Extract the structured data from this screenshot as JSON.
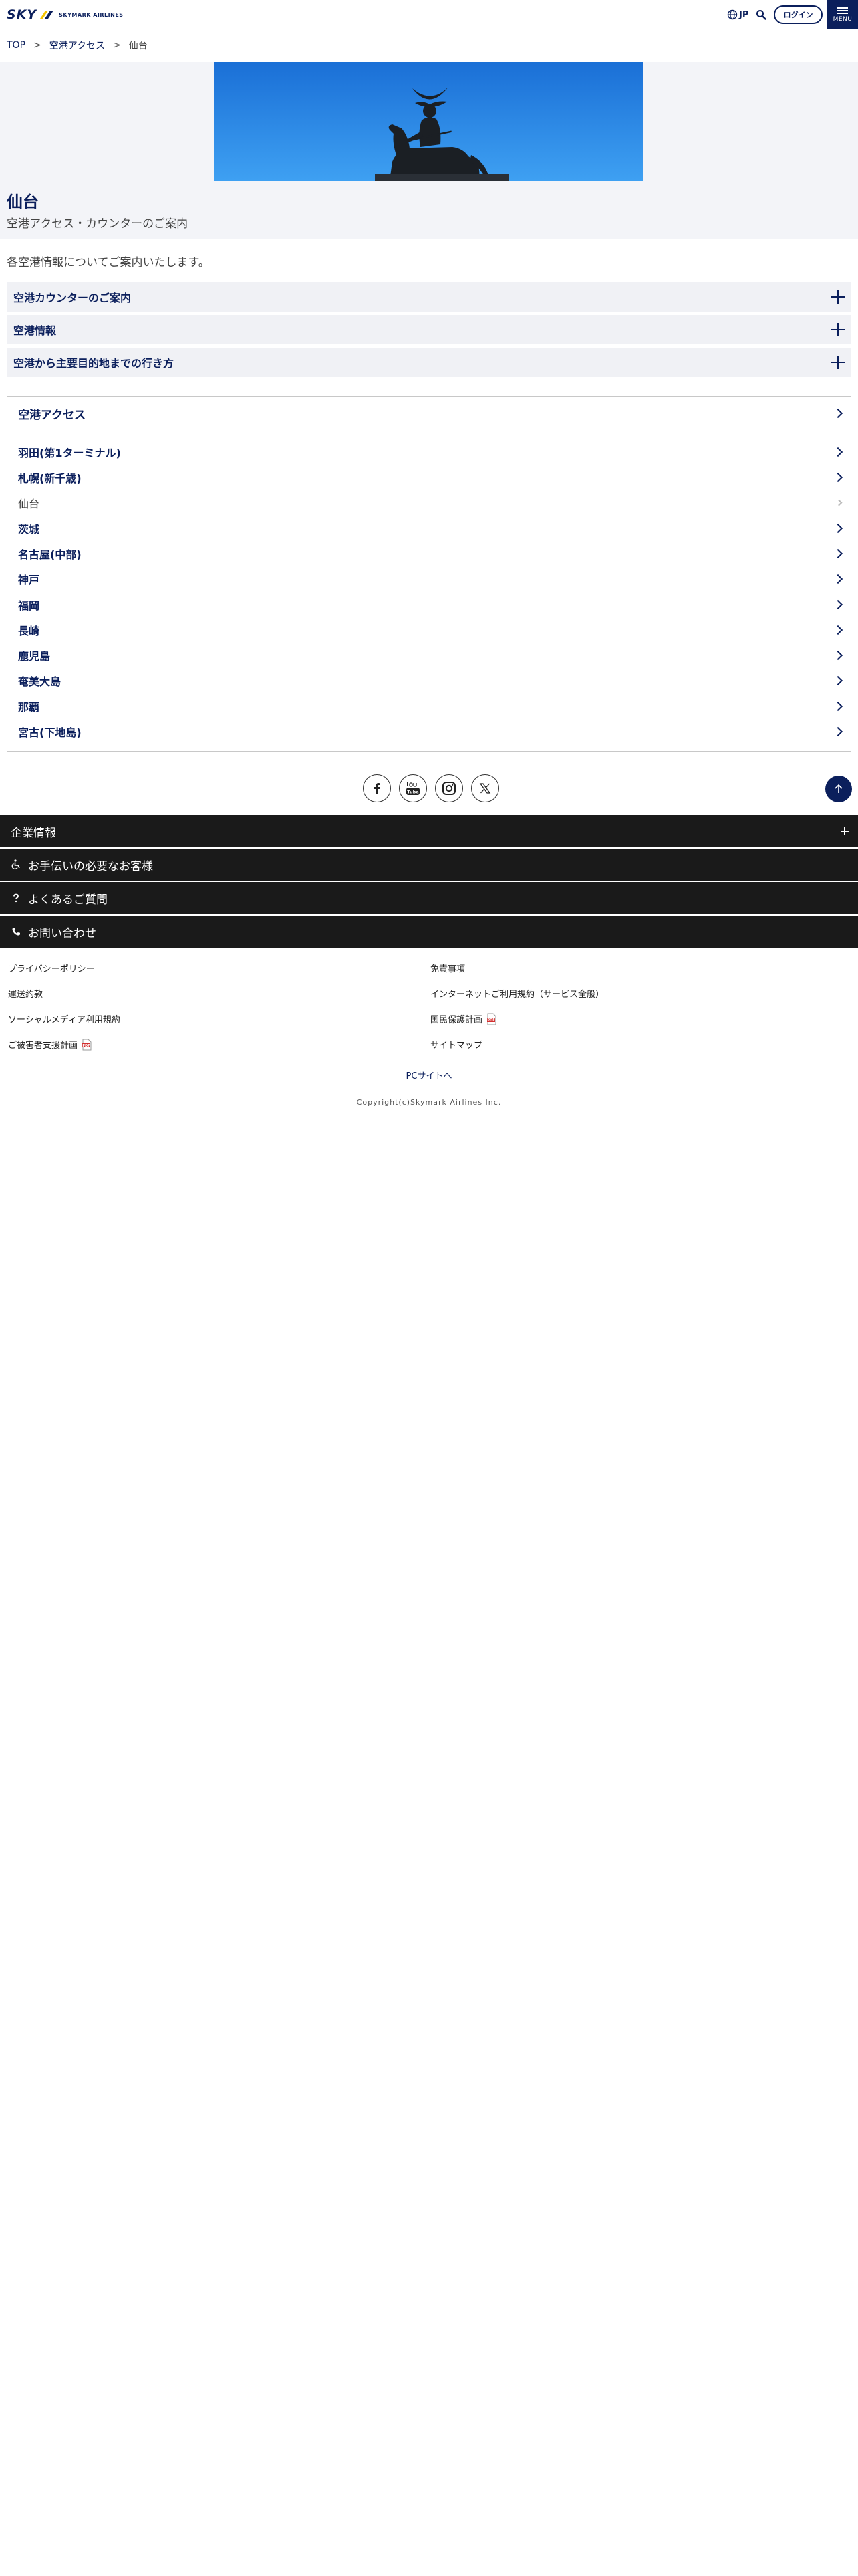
{
  "header": {
    "logo_text": "SKY",
    "logo_sub": "SKYMARK AIRLINES",
    "lang_label": "JP",
    "login_label": "ログイン",
    "menu_label": "MENU"
  },
  "breadcrumb": {
    "items": [
      "TOP",
      "空港アクセス",
      "仙台"
    ],
    "separator": ">"
  },
  "page": {
    "title": "仙台",
    "subtitle": "空港アクセス・カウンターのご案内",
    "intro": "各空港情報についてご案内いたします。"
  },
  "accordions": [
    {
      "label": "空港カウンターのご案内"
    },
    {
      "label": "空港情報"
    },
    {
      "label": "空港から主要目的地までの行き方"
    }
  ],
  "airport_access": {
    "heading": "空港アクセス",
    "items": [
      {
        "label": "羽田(第1ターミナル)",
        "current": false
      },
      {
        "label": "札幌(新千歳)",
        "current": false
      },
      {
        "label": "仙台",
        "current": true
      },
      {
        "label": "茨城",
        "current": false
      },
      {
        "label": "名古屋(中部)",
        "current": false
      },
      {
        "label": "神戸",
        "current": false
      },
      {
        "label": "福岡",
        "current": false
      },
      {
        "label": "長崎",
        "current": false
      },
      {
        "label": "鹿児島",
        "current": false
      },
      {
        "label": "奄美大島",
        "current": false
      },
      {
        "label": "那覇",
        "current": false
      },
      {
        "label": "宮古(下地島)",
        "current": false
      }
    ]
  },
  "social_icons": [
    "facebook-icon",
    "youtube-icon",
    "instagram-icon",
    "x-icon"
  ],
  "footer_nav": [
    {
      "label": "企業情報",
      "icon": "",
      "expandable": true
    },
    {
      "label": "お手伝いの必要なお客様",
      "icon": "wheelchair-icon",
      "expandable": false
    },
    {
      "label": "よくあるご質問",
      "icon": "question-icon",
      "expandable": false
    },
    {
      "label": "お問い合わせ",
      "icon": "phone-icon",
      "expandable": false
    }
  ],
  "footer_links": {
    "left": [
      {
        "label": "プライバシーポリシー",
        "pdf": false
      },
      {
        "label": "運送約款",
        "pdf": false
      },
      {
        "label": "ソーシャルメディア利用規約",
        "pdf": false
      },
      {
        "label": "ご被害者支援計画",
        "pdf": true
      }
    ],
    "right": [
      {
        "label": "免責事項",
        "pdf": false
      },
      {
        "label": "インターネットご利用規約（サービス全般）",
        "pdf": false
      },
      {
        "label": "国民保護計画",
        "pdf": true
      },
      {
        "label": "サイトマップ",
        "pdf": false
      }
    ]
  },
  "pc_site_label": "PCサイトへ",
  "copyright": "Copyright(c)Skymark Airlines Inc.",
  "colors": {
    "navy": "#0b1f5c",
    "footer_dark": "#1a1a1a",
    "hero_sky": "#1e88e5",
    "section_bg": "#f3f4f8"
  }
}
